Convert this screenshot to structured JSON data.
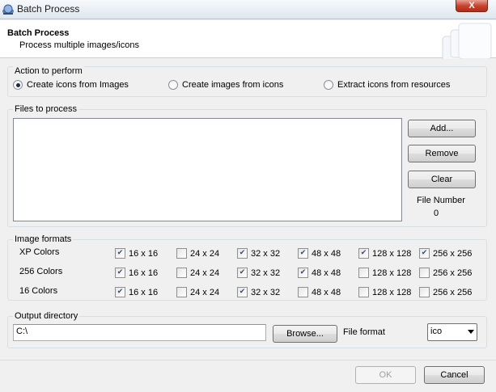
{
  "window": {
    "title": "Batch Process",
    "close_label": "X"
  },
  "header": {
    "title": "Batch Process",
    "subtitle": "Process multiple images/icons"
  },
  "action": {
    "label": "Action to perform",
    "options": [
      {
        "label": "Create icons from Images",
        "checked": true
      },
      {
        "label": "Create images from icons",
        "checked": false
      },
      {
        "label": "Extract icons from resources",
        "checked": false
      }
    ]
  },
  "files": {
    "label": "Files to process",
    "add_label": "Add...",
    "remove_label": "Remove",
    "clear_label": "Clear",
    "file_number_label": "File Number",
    "file_number_value": "0"
  },
  "formats": {
    "label": "Image formats",
    "rows": [
      {
        "name": "XP Colors",
        "sizes": [
          {
            "label": "16 x 16",
            "checked": true
          },
          {
            "label": "24 x 24",
            "checked": false
          },
          {
            "label": "32 x 32",
            "checked": true
          },
          {
            "label": "48 x 48",
            "checked": true
          },
          {
            "label": "128 x 128",
            "checked": true
          },
          {
            "label": "256 x 256",
            "checked": true
          }
        ]
      },
      {
        "name": "256 Colors",
        "sizes": [
          {
            "label": "16 x 16",
            "checked": true
          },
          {
            "label": "24 x 24",
            "checked": false
          },
          {
            "label": "32 x 32",
            "checked": true
          },
          {
            "label": "48 x 48",
            "checked": true
          },
          {
            "label": "128 x 128",
            "checked": false
          },
          {
            "label": "256 x 256",
            "checked": false
          }
        ]
      },
      {
        "name": "16 Colors",
        "sizes": [
          {
            "label": "16 x 16",
            "checked": true
          },
          {
            "label": "24 x 24",
            "checked": false
          },
          {
            "label": "32 x 32",
            "checked": true
          },
          {
            "label": "48 x 48",
            "checked": false
          },
          {
            "label": "128 x 128",
            "checked": false
          },
          {
            "label": "256 x 256",
            "checked": false
          }
        ]
      }
    ]
  },
  "output": {
    "label": "Output directory",
    "directory_value": "C:\\",
    "browse_label": "Browse...",
    "format_label": "File format",
    "format_value": "ico"
  },
  "footer": {
    "ok_label": "OK",
    "cancel_label": "Cancel"
  }
}
